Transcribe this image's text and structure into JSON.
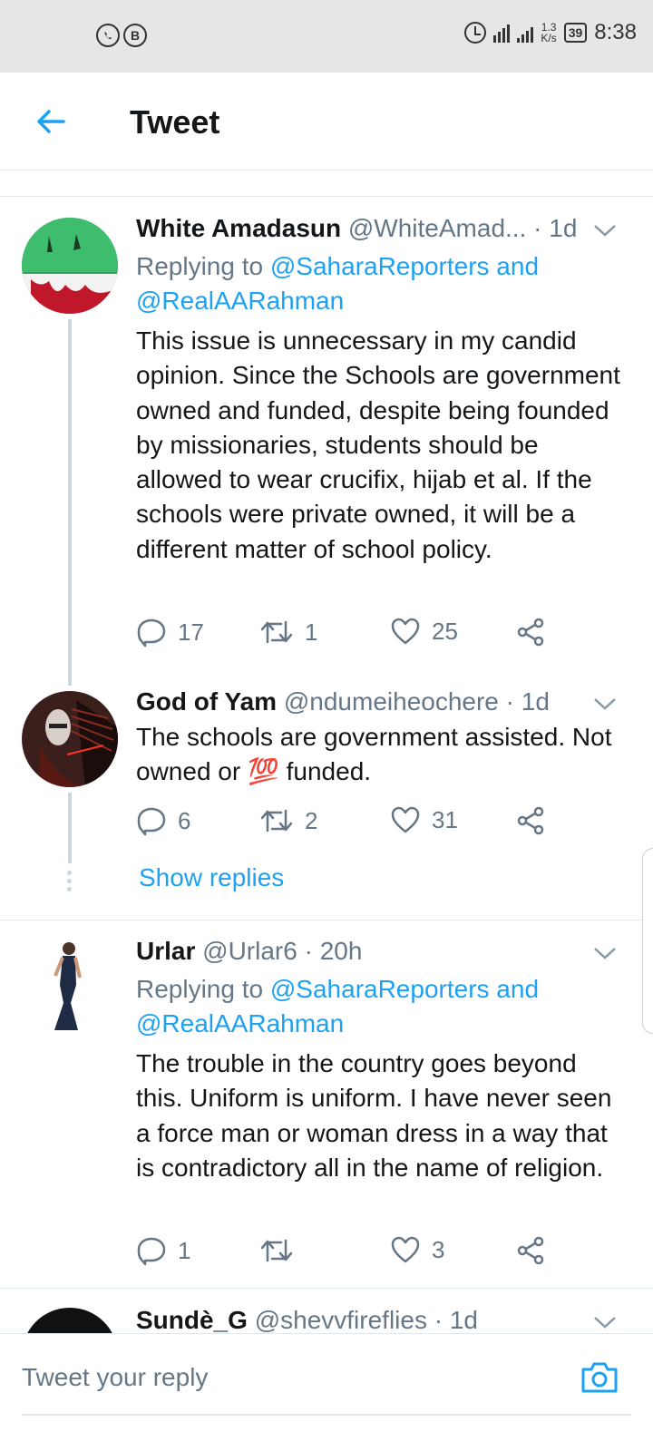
{
  "status_bar": {
    "left_icons": [
      "whatsapp-icon",
      "b-app-icon"
    ],
    "network_speed_value": "1.3",
    "network_speed_unit": "K/s",
    "battery": "39",
    "time": "8:38"
  },
  "header": {
    "title": "Tweet"
  },
  "tweets": [
    {
      "name": "White Amadasun",
      "handle": "@WhiteAmad...",
      "time": "· 1d",
      "replying_prefix": "Replying to ",
      "replying_users": "@SaharaReporters and @RealAARahman",
      "body": "This issue is unnecessary in my candid opinion. Since the Schools are government owned and funded, despite being founded by missionaries, students should be allowed to wear crucifix, hijab et al. If the schools were private owned, it will be a different matter of school policy.",
      "replies": "17",
      "retweets": "1",
      "likes": "25"
    },
    {
      "name": "God of Yam",
      "handle": "@ndumeiheochere",
      "time": "· 1d",
      "body_before": "The schools are government assisted. Not owned or ",
      "emoji": "💯",
      "body_after": " funded.",
      "replies": "6",
      "retweets": "2",
      "likes": "31"
    },
    {
      "name": "Urlar",
      "handle": "@Urlar6",
      "time": "· 20h",
      "replying_prefix": "Replying to ",
      "replying_users": "@SaharaReporters and @RealAARahman",
      "body": "The trouble in the country goes beyond this.  Uniform is uniform. I have never seen a force man or woman dress in a way that is contradictory all in the name of religion.",
      "replies": "1",
      "retweets": "",
      "likes": "3"
    },
    {
      "name": "Sundè_G",
      "handle": "@shevvfireflies",
      "time": "· 1d"
    }
  ],
  "show_replies": "Show replies",
  "compose": {
    "placeholder": "Tweet your reply"
  },
  "colors": {
    "accent": "#1da1f2",
    "muted": "#657786",
    "text": "#14171a",
    "status_bar": "#e6e6e6"
  }
}
